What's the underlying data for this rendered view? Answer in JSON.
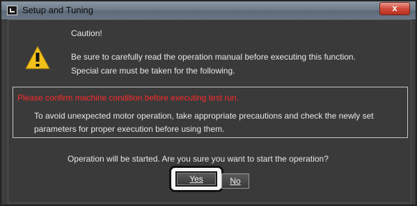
{
  "window": {
    "title": "Setup and Tuning",
    "close_label": "x"
  },
  "dialog": {
    "caution_title": "Caution!",
    "caution_line1": "Be sure to carefully read the operation manual before executing this function.",
    "caution_line2": "Special care must be taken for the following.",
    "warning_heading": "Please confirm machine condition before executing test run.",
    "warning_line1": "To avoid unexpected motor operation, take appropriate precautions and check the newly set",
    "warning_line2": "parameters for proper execution before using them.",
    "question": "Operation will be started. Are you sure you want to start the operation?",
    "yes_label": "Yes",
    "no_label": "No"
  },
  "colors": {
    "warning_text": "#ff2a2a",
    "warning_icon": "#f2c21a"
  }
}
